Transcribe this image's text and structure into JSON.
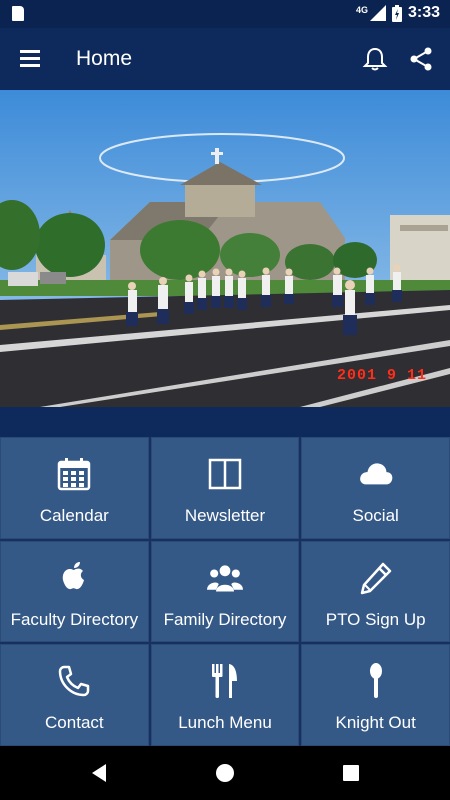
{
  "status": {
    "network": "4G",
    "time": "3:33"
  },
  "appbar": {
    "title": "Home"
  },
  "hero": {
    "date_stamp": "2001   9  11"
  },
  "tiles": [
    {
      "label": "Calendar",
      "icon": "calendar-icon"
    },
    {
      "label": "Newsletter",
      "icon": "newsletter-icon"
    },
    {
      "label": "Social",
      "icon": "cloud-icon"
    },
    {
      "label": "Faculty Directory",
      "icon": "apple-icon"
    },
    {
      "label": "Family Directory",
      "icon": "users-icon"
    },
    {
      "label": "PTO Sign Up",
      "icon": "pencil-icon"
    },
    {
      "label": "Contact",
      "icon": "phone-icon"
    },
    {
      "label": "Lunch Menu",
      "icon": "utensils-icon"
    },
    {
      "label": "Knight Out",
      "icon": "spoon-icon"
    }
  ],
  "colors": {
    "appbar": "#0e2a5c",
    "tile": "#355987",
    "tile_border": "#2a4a78"
  }
}
